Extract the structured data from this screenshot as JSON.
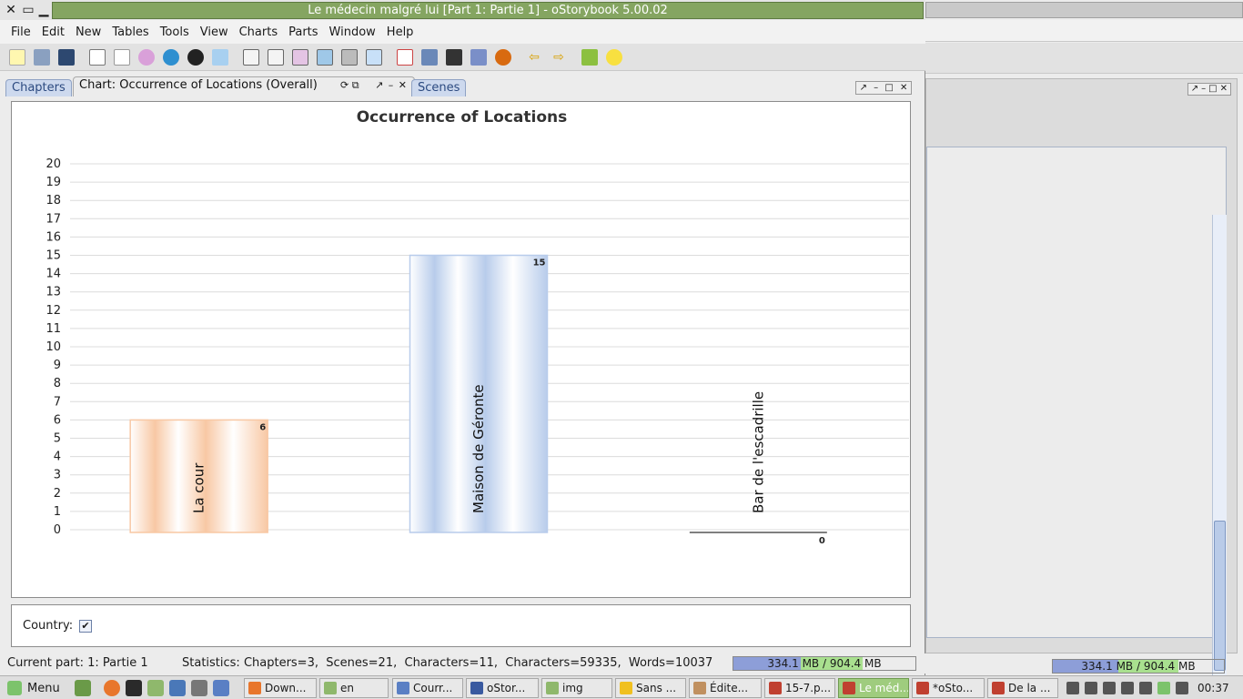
{
  "window": {
    "title": "Le médecin malgré lui [Part 1: Partie 1] - oStorybook 5.00.02",
    "controls": [
      "close-icon",
      "restore-icon",
      "minimize-icon"
    ]
  },
  "menu": [
    "File",
    "Edit",
    "New",
    "Tables",
    "Tools",
    "View",
    "Charts",
    "Parts",
    "Window",
    "Help"
  ],
  "toolbar_icons": [
    "new-file-icon",
    "open-folder-icon",
    "save-icon",
    "new-chapter-icon",
    "new-scene-icon",
    "new-character-icon",
    "new-location-icon",
    "new-item-icon",
    "new-tag-icon",
    "chapters-table-icon",
    "scenes-table-icon",
    "characters-table-icon",
    "locations-table-icon",
    "items-table-icon",
    "tags-table-icon",
    "calendar-icon",
    "book-icon",
    "manage-icon",
    "reading-icon",
    "memoria-icon",
    "previous-part-icon",
    "next-part-icon",
    "idea-folder-icon",
    "lightbulb-icon"
  ],
  "tabs": {
    "chapters": "Chapters",
    "chart": "Chart: Occurrence of Locations (Overall)",
    "scenes": "Scenes"
  },
  "chart_data": {
    "type": "bar",
    "title": "Occurrence of Locations",
    "categories": [
      "La cour",
      "Maison de Géronte",
      "Bar de l'escadrille"
    ],
    "values": [
      6,
      15,
      0
    ],
    "colors": [
      "#f8c8a4",
      "#b8cceb",
      "#b8cceb"
    ],
    "ylim": [
      0,
      20
    ],
    "yticks": [
      0,
      1,
      2,
      3,
      4,
      5,
      6,
      7,
      8,
      9,
      10,
      11,
      12,
      13,
      14,
      15,
      16,
      17,
      18,
      19,
      20
    ],
    "grid": true,
    "xlabel": "",
    "ylabel": ""
  },
  "options": {
    "country_label": "Country:",
    "country_checked": true,
    "check_glyph": "✔"
  },
  "status": {
    "current_part": "Current part: 1: Partie 1",
    "statistics": "Statistics: Chapters=3,  Scenes=21,  Characters=11,  Characters=59335,  Words=10037",
    "memory": "334.1 MB / 904.4 MB"
  },
  "background_window": {
    "memory": "334.1 MB / 904.4 MB"
  },
  "taskbar": {
    "menu_label": "Menu",
    "tasks": [
      "Down...",
      "en",
      "Courr...",
      "oStor...",
      "img",
      "Sans ...",
      "Édite...",
      "15-7.p...",
      "Le méd...",
      "*oSto...",
      "De la ..."
    ],
    "active_task_index": 8,
    "clock": "00:37"
  }
}
